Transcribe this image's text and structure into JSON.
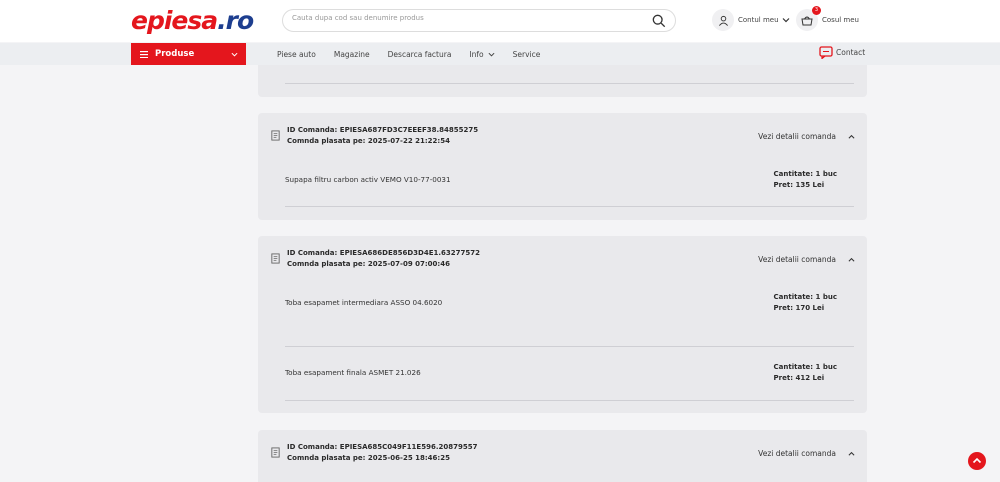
{
  "header": {
    "logo_text": "epiesa",
    "logo_dot": ".ro",
    "search_placeholder": "Cauta dupa cod sau denumire produs",
    "account_label": "Contul meu",
    "cart_label": "Cosul meu",
    "cart_count": "3"
  },
  "nav": {
    "products_label": "Produse",
    "links": [
      "Piese auto",
      "Magazine",
      "Descarca factura",
      "Info",
      "Service"
    ],
    "contact_label": "Contact"
  },
  "orders": [
    {
      "id_label": "ID Comanda:",
      "id": "EPIESA687FD3C7EEEF38.84855275",
      "date_label": "Comnda plasata pe:",
      "date": "2025-07-22 21:22:54",
      "details_label": "Vezi detalii comanda",
      "items": [
        {
          "name": "Supapa filtru carbon activ VEMO V10-77-0031",
          "qty_label": "Cantitate:",
          "qty": "1 buc",
          "price_label": "Pret:",
          "price": "135 Lei"
        }
      ]
    },
    {
      "id_label": "ID Comanda:",
      "id": "EPIESA686DE856D3D4E1.63277572",
      "date_label": "Comnda plasata pe:",
      "date": "2025-07-09 07:00:46",
      "details_label": "Vezi detalii comanda",
      "items": [
        {
          "name": "Toba esapamet intermediara ASSO 04.6020",
          "qty_label": "Cantitate:",
          "qty": "1 buc",
          "price_label": "Pret:",
          "price": "170 Lei"
        },
        {
          "name": "Toba esapament finala ASMET 21.026",
          "qty_label": "Cantitate:",
          "qty": "1 buc",
          "price_label": "Pret:",
          "price": "412 Lei"
        }
      ]
    },
    {
      "id_label": "ID Comanda:",
      "id": "EPIESA685C049F11E596.20879557",
      "date_label": "Comnda plasata pe:",
      "date": "2025-06-25 18:46:25",
      "details_label": "Vezi detalii comanda",
      "items": []
    }
  ],
  "colors": {
    "brand_red": "#e4161d",
    "brand_blue": "#1d3e8f"
  }
}
